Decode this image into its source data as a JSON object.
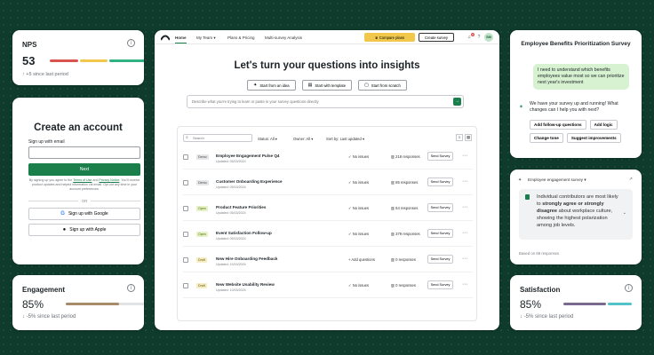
{
  "nps": {
    "title": "NPS",
    "value": "53",
    "delta": "↑ +5 since last period",
    "segments": [
      {
        "fraction": 0.31,
        "color": "#d9534f"
      },
      {
        "fraction": 0.3,
        "color": "#f1c84b"
      },
      {
        "fraction": 0.39,
        "color": "#2fb383"
      }
    ]
  },
  "signup": {
    "heading": "Create an account",
    "email_label": "Sign up with email",
    "next_label": "Next",
    "legal_pre": "By signing up you agree to the ",
    "terms": "Terms of Use",
    "legal_mid": " and ",
    "privacy": "Privacy Notice",
    "legal_post": ". You'll receive product updates and helpful information via email. Opt out any time in your account preferences.",
    "or_label": "OR",
    "google_label": "Sign up with Google",
    "apple_label": "Sign up with Apple"
  },
  "engagement": {
    "title": "Engagement",
    "value": "85%",
    "fill_fraction": 0.66,
    "fill_color": "#a88b68",
    "delta": "↓ -5% since last period"
  },
  "app": {
    "nav": {
      "home": "Home",
      "my_team": "My Team ▾",
      "plans": "Plans & Pricing",
      "multi": "Multi-survey Analysis",
      "compare": "Compare plans",
      "create": "Create survey",
      "notif_count": "9",
      "avatar": "SM"
    },
    "hero": "Let's turn your questions into insights",
    "starts": [
      {
        "icon": "✦",
        "label": "Start from an idea"
      },
      {
        "icon": "▤",
        "label": "Start with template"
      },
      {
        "icon": "▢",
        "label": "Start from scratch"
      }
    ],
    "ask_placeholder": "Describe what you're trying to learn or paste in your survey questions directly",
    "search_placeholder": "Search",
    "filters": {
      "status": "Status: All ▾",
      "owner": "Owner: All ▾",
      "sort": "Sort by: Last updated ▾"
    },
    "surveys": [
      {
        "badge": "Demo",
        "name": "Employee Engagement Pulse Q4",
        "date": "Updated: 05/15/2024",
        "issue_icon": "✓",
        "issue": "No issues",
        "responses": "218 responses",
        "action": "Send Survey"
      },
      {
        "badge": "Demo",
        "name": "Customer Onboarding Experience",
        "date": "Updated: 05/15/2024",
        "issue_icon": "✓",
        "issue": "No issues",
        "responses": "85 responses",
        "action": "Send Survey"
      },
      {
        "badge": "Open",
        "name": "Product Feature Priorities",
        "date": "Updated: 05/15/2024",
        "issue_icon": "✓",
        "issue": "No issues",
        "responses": "64 responses",
        "action": "Send Survey"
      },
      {
        "badge": "Open",
        "name": "Event Satisfaction Follow-up",
        "date": "Updated: 05/15/2024",
        "issue_icon": "✓",
        "issue": "No issues",
        "responses": "379 responses",
        "action": "Send Survey"
      },
      {
        "badge": "Draft",
        "name": "New Hire Onboarding Feedback",
        "date": "Updated: 10/15/2024",
        "issue_icon": "+",
        "issue": "Add questions",
        "responses": "0 responses",
        "action": "Send Survey"
      },
      {
        "badge": "Draft",
        "name": "New Website Usability Review",
        "date": "Updated: 10/15/2024",
        "issue_icon": "✓",
        "issue": "No issues",
        "responses": "0 responses",
        "action": "Send Survey"
      }
    ]
  },
  "chat": {
    "title": "Employee Benefits Prioritization Survey",
    "user_msg": "I need to understand which benefits employees value most so we can prioritize next year's investment",
    "bot_msg": "We have your survey up and running! What changes can I help you with next?",
    "chips": [
      "Add follow-up questions",
      "Add logic",
      "Change tone",
      "Suggest improvements"
    ]
  },
  "insight": {
    "header": "Employee engagement survey ▾",
    "text_pre": "Individual contributors are most likely to ",
    "text_bold": "strongly agree or strongly disagree",
    "text_post": " about workplace culture, showing the highest polarization among job levels.",
    "footer": "Based on 68 responses"
  },
  "satisfaction": {
    "title": "Satisfaction",
    "value": "85%",
    "delta": "↓ -5% since last period",
    "segments": [
      {
        "fraction": 0.64,
        "color": "#7b6a8f"
      },
      {
        "fraction": 0.36,
        "color": "#54c3c9"
      }
    ]
  }
}
